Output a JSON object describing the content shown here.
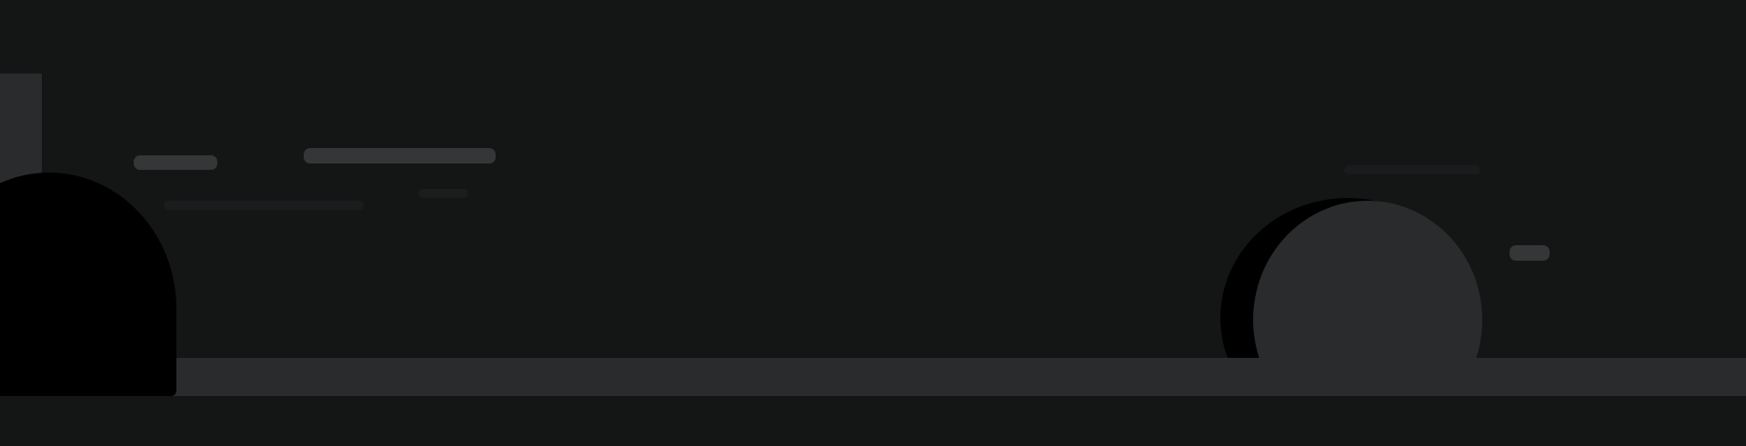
{
  "colors": {
    "background": "#141515",
    "panel": "#2a2b2d",
    "placeholder": "#353637",
    "faint_placeholder": "#1b1c1d",
    "silhouette": "#000000"
  },
  "skeleton": {
    "left_placeholders": [
      {
        "name": "short-placeholder-bar",
        "color": "#353637"
      },
      {
        "name": "long-placeholder-bar",
        "color": "#353637"
      },
      {
        "name": "faint-placeholder-bar",
        "color": "#1b1c1d"
      },
      {
        "name": "faint-placeholder-bar-small",
        "color": "#1b1c1d"
      }
    ],
    "right_placeholders": [
      {
        "name": "small-placeholder-pill",
        "color": "#353637"
      }
    ]
  }
}
